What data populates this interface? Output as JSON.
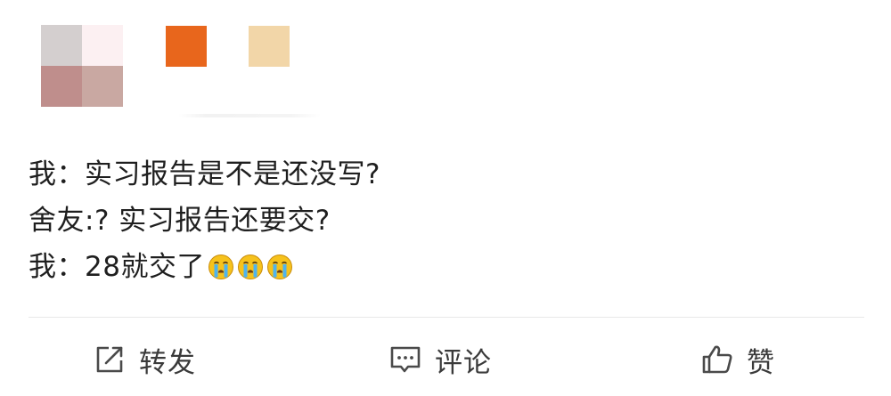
{
  "post": {
    "lines": [
      "我：实习报告是不是还没写?",
      "舍友:? 实习报告还要交?",
      "我：28就交了"
    ],
    "trailing_emoji": [
      "crying-face-icon",
      "crying-face-icon",
      "crying-face-icon"
    ]
  },
  "actions": {
    "repost_label": "转发",
    "comment_label": "评论",
    "like_label": "赞"
  },
  "colors": {
    "avatar_pixels": [
      "#d4cfcf",
      "#fcf0f2",
      "#bf8e8c",
      "#c9a8a2"
    ],
    "badge_orange": "#e8661c",
    "badge_tan": "#f2d6a8",
    "text": "#1f1f1f",
    "action_text": "#3a3a3a",
    "divider": "#e8e8e8"
  }
}
